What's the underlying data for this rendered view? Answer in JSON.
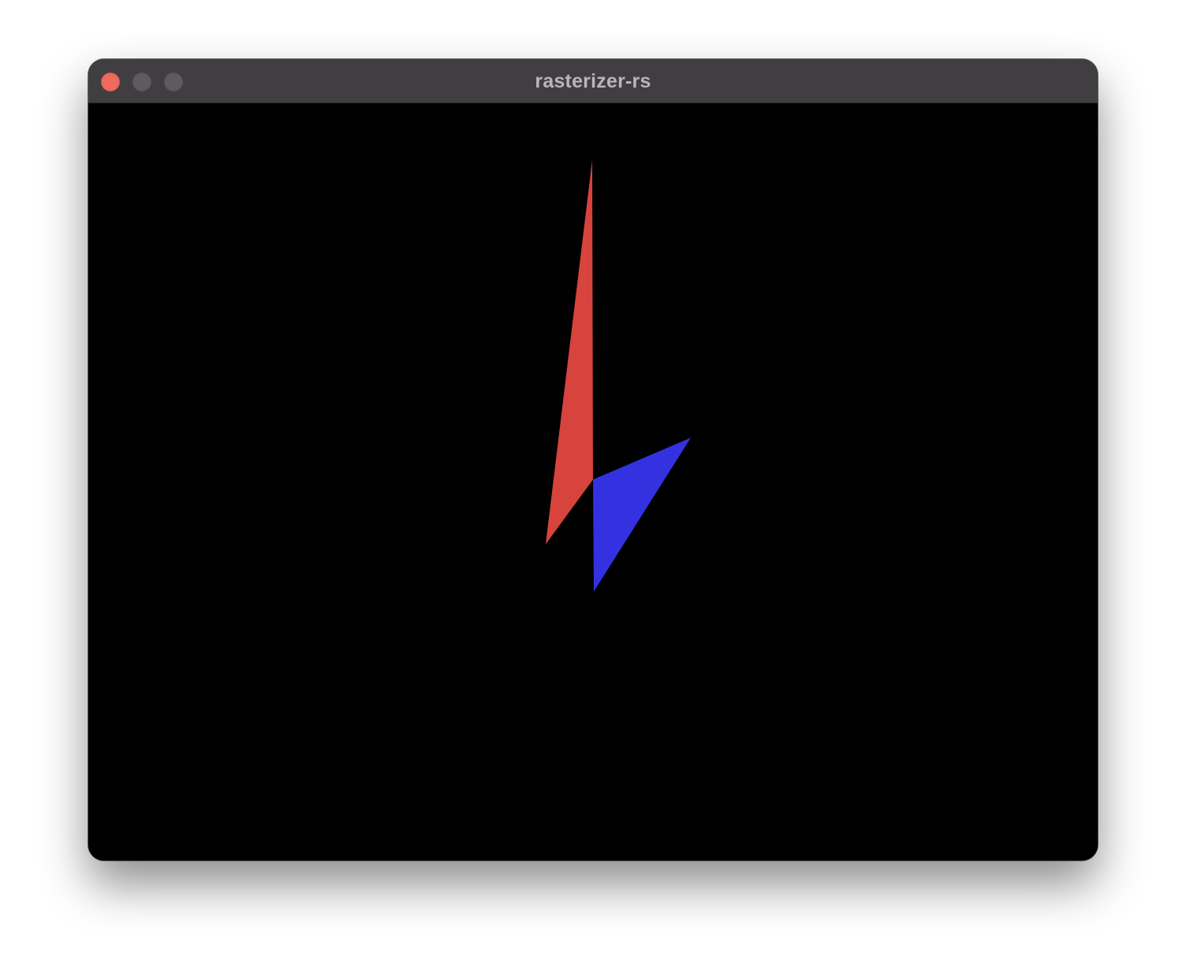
{
  "window": {
    "title": "rasterizer-rs",
    "controls": {
      "close_color": "#ec6a5e",
      "minimize_color": "#5d5b5d",
      "zoom_color": "#5d5b5d"
    }
  },
  "scene": {
    "background": "#000000",
    "triangles": [
      {
        "name": "red-triangle",
        "color": "#d6443d"
      },
      {
        "name": "blue-triangle",
        "color": "#3432e0"
      }
    ]
  }
}
